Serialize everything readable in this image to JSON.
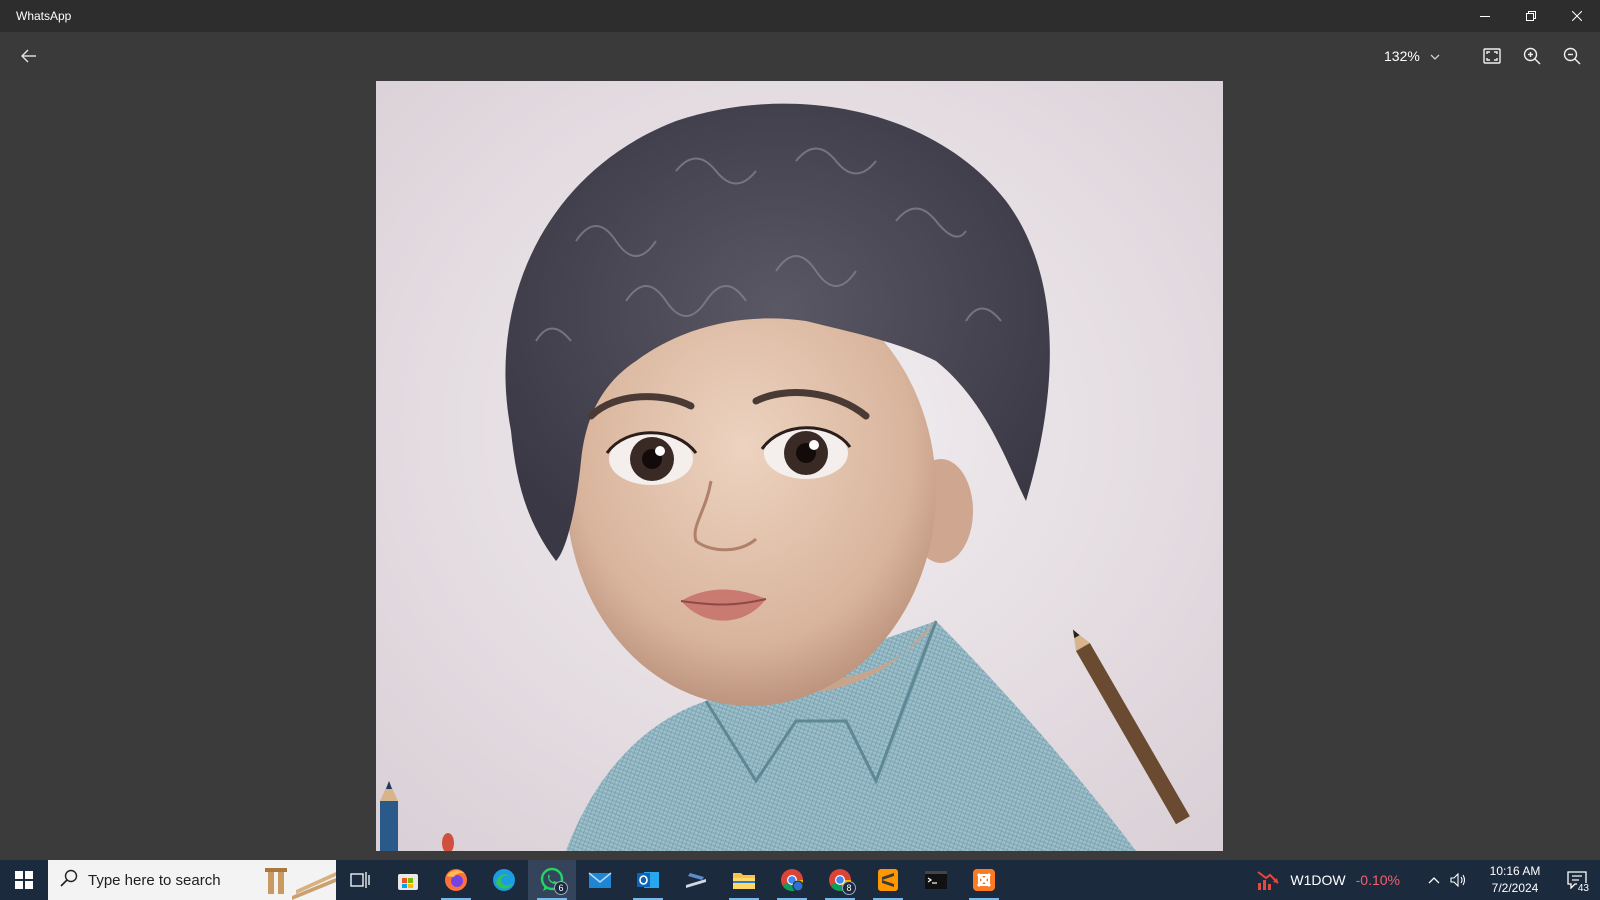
{
  "window": {
    "title": "WhatsApp",
    "controls": [
      "minimize",
      "restore",
      "close"
    ]
  },
  "toolbar": {
    "back_icon": "arrow-left-icon",
    "zoom_level": "132%",
    "zoom_dropdown_icon": "chevron-down-icon",
    "fit_icon": "fit-to-window-icon",
    "zoom_in_icon": "zoom-in-icon",
    "zoom_out_icon": "zoom-out-icon"
  },
  "viewer": {
    "image_subject": "pencil drawing of a curly-haired child in a light blue striped shirt",
    "background": "#3b3b3b"
  },
  "taskbar": {
    "search_placeholder": "Type here to search",
    "apps": [
      {
        "name": "task-view",
        "icon": "task-view-icon"
      },
      {
        "name": "microsoft-store",
        "icon": "store-icon"
      },
      {
        "name": "firefox",
        "icon": "firefox-icon"
      },
      {
        "name": "edge",
        "icon": "edge-icon"
      },
      {
        "name": "whatsapp",
        "icon": "whatsapp-icon",
        "badge": "6",
        "active": true
      },
      {
        "name": "mail",
        "icon": "mail-icon"
      },
      {
        "name": "outlook",
        "icon": "outlook-icon"
      },
      {
        "name": "app",
        "icon": "app-icon"
      },
      {
        "name": "file-explorer",
        "icon": "folder-icon"
      },
      {
        "name": "chrome-profile",
        "icon": "chrome-icon"
      },
      {
        "name": "chrome",
        "icon": "chrome-icon",
        "badge": "8"
      },
      {
        "name": "sublime-text",
        "icon": "sublime-icon"
      },
      {
        "name": "terminal",
        "icon": "terminal-icon"
      },
      {
        "name": "xampp",
        "icon": "xampp-icon"
      }
    ],
    "stock": {
      "name": "W1DOW",
      "change": "-0.10%"
    },
    "time": "10:16 AM",
    "date": "7/2/2024",
    "notification_count": "43"
  }
}
